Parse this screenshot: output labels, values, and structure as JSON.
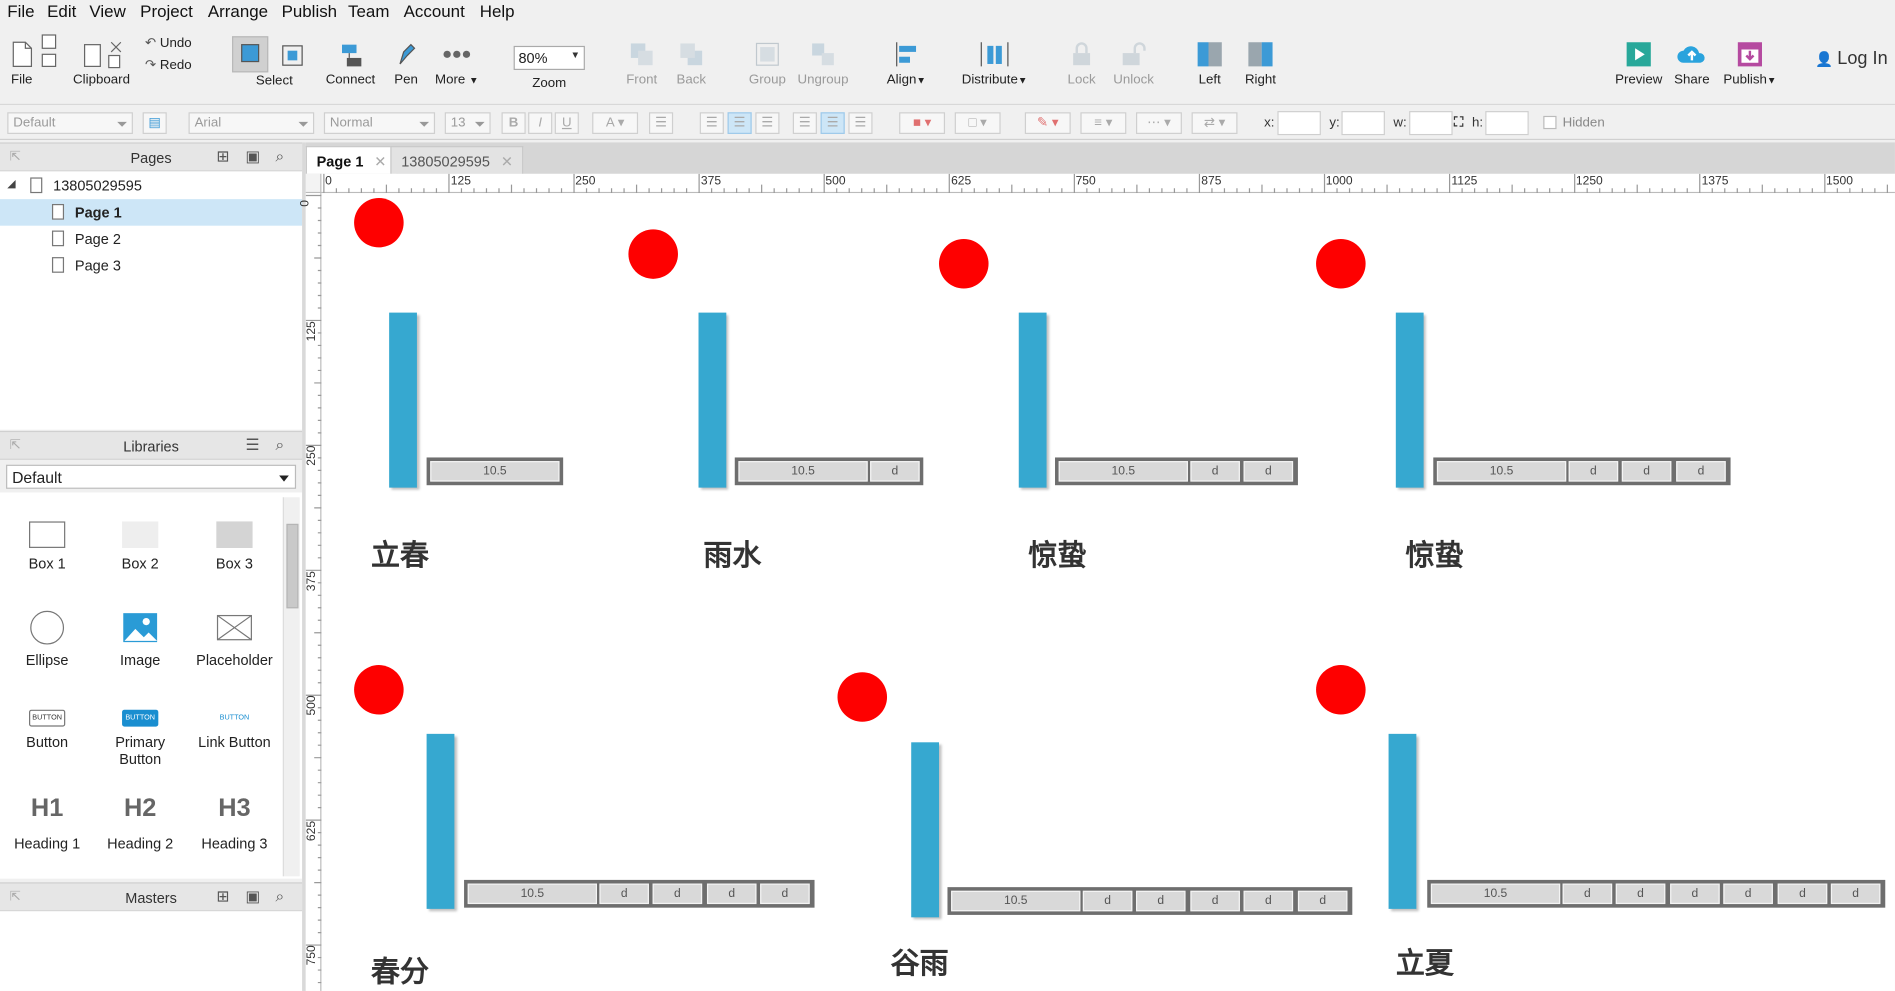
{
  "menu": [
    "File",
    "Edit",
    "View",
    "Project",
    "Arrange",
    "Publish",
    "Team",
    "Account",
    "Help"
  ],
  "toolbar": {
    "file": "File",
    "clipboard": "Clipboard",
    "undo": "Undo",
    "redo": "Redo",
    "select": "Select",
    "connect": "Connect",
    "pen": "Pen",
    "more": "More",
    "zoom_value": "80%",
    "zoom": "Zoom",
    "front": "Front",
    "back": "Back",
    "group": "Group",
    "ungroup": "Ungroup",
    "align": "Align",
    "distribute": "Distribute",
    "lock": "Lock",
    "unlock": "Unlock",
    "left": "Left",
    "right": "Right",
    "preview": "Preview",
    "share": "Share",
    "publish": "Publish",
    "login": "Log In"
  },
  "format": {
    "style": "Default",
    "font": "Arial",
    "weight": "Normal",
    "size": "13",
    "x_label": "x:",
    "y_label": "y:",
    "w_label": "w:",
    "h_label": "h:",
    "hidden": "Hidden"
  },
  "pages_panel": {
    "title": "Pages",
    "root": "13805029595",
    "pages": [
      "Page 1",
      "Page 2",
      "Page 3"
    ],
    "selected": "Page 1"
  },
  "libraries_panel": {
    "title": "Libraries",
    "selected_library": "Default",
    "widgets": [
      "Box 1",
      "Box 2",
      "Box 3",
      "Ellipse",
      "Image",
      "Placeholder",
      "Button",
      "Primary Button",
      "Link Button",
      "Heading 1",
      "Heading 2",
      "Heading 3"
    ],
    "button_text": "BUTTON",
    "h1": "H1",
    "h2": "H2",
    "h3": "H3"
  },
  "masters_panel": {
    "title": "Masters"
  },
  "tabs": [
    {
      "label": "Page 1",
      "active": true
    },
    {
      "label": "13805029595",
      "active": false
    }
  ],
  "ruler": {
    "h": [
      "0",
      "125",
      "250",
      "375",
      "500",
      "625",
      "750",
      "875",
      "1000",
      "1125",
      "1250",
      "1375",
      "1500"
    ],
    "v": [
      "0",
      "125",
      "250",
      "375",
      "500",
      "625",
      "750"
    ]
  },
  "canvas": {
    "groups": [
      {
        "title": "立春",
        "value": "10.5",
        "cells": []
      },
      {
        "title": "雨水",
        "value": "10.5",
        "cells": [
          "d"
        ]
      },
      {
        "title": "惊蛰",
        "value": "10.5",
        "cells": [
          "d",
          "d"
        ]
      },
      {
        "title": "惊蛰",
        "value": "10.5",
        "cells": [
          "d",
          "d",
          "d"
        ]
      },
      {
        "title": "春分",
        "value": "10.5",
        "cells": [
          "d",
          "d",
          "d",
          "d"
        ]
      },
      {
        "title": "谷雨",
        "value": "10.5",
        "cells": [
          "d",
          "d",
          "d",
          "d",
          "d"
        ]
      },
      {
        "title": "立夏",
        "value": "10.5",
        "cells": [
          "d",
          "d",
          "d",
          "d",
          "d",
          "d"
        ]
      }
    ]
  },
  "colors": {
    "accent": "#36a8d0",
    "dot": "#fe0000",
    "selection": "#cde6f7"
  }
}
